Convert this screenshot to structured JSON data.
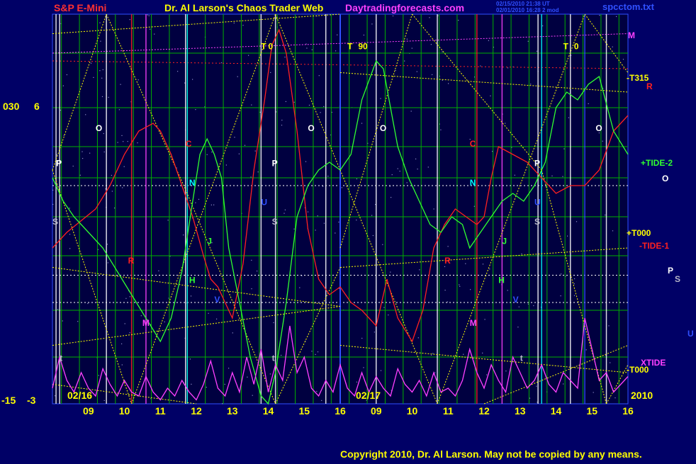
{
  "header": {
    "left_title": "S&P E-Mini",
    "center_title": "Dr. Al Larson's Chaos Trader Web",
    "site": "Daytradingforecasts.com",
    "stamp1": "02/15/2010 21:38 UT",
    "stamp2": "02/01/2010 16:28 2 mod",
    "file": "spcctom.txt"
  },
  "footer": {
    "copyright": "Copyright 2010, Dr. Al Larson. May not be copied by any means."
  },
  "left_scale": {
    "top_a": "030",
    "top_b": "6",
    "bottom_a": "-15",
    "bottom_b": "-3"
  },
  "colors": {
    "background": "#000066",
    "grid_green": "#00b000",
    "white": "#ffffff",
    "red": "#ff2020",
    "magenta": "#ff40ff",
    "yellow": "#ffff00",
    "green": "#30ff30",
    "cyan": "#00ffff",
    "blue": "#3050ff",
    "gray": "#b8b8c8"
  },
  "chart_data": {
    "type": "line",
    "title": "S&P E-Mini",
    "date_labels": [
      "02/16",
      "02/17"
    ],
    "year_label": "2010",
    "x_ticks": [
      "09",
      "10",
      "11",
      "12",
      "13",
      "14",
      "15",
      "16",
      "09",
      "10",
      "11",
      "12",
      "13",
      "14",
      "15",
      "16"
    ],
    "right_labels": [
      {
        "text": "M",
        "color": "magenta"
      },
      {
        "text": "-T315",
        "color": "yellow"
      },
      {
        "text": "R",
        "color": "red"
      },
      {
        "text": "+TIDE-2",
        "color": "green"
      },
      {
        "text": "O",
        "color": "white"
      },
      {
        "text": "+T000",
        "color": "yellow"
      },
      {
        "text": "-TIDE-1",
        "color": "red"
      },
      {
        "text": "P",
        "color": "white"
      },
      {
        "text": "S",
        "color": "gray"
      },
      {
        "text": "U",
        "color": "blue"
      },
      {
        "text": "XTIDE",
        "color": "magenta"
      },
      {
        "text": "-T000",
        "color": "yellow"
      }
    ],
    "day1_markers": [
      {
        "text": "O",
        "color": "white"
      },
      {
        "text": "P",
        "color": "white"
      },
      {
        "text": "S",
        "color": "gray"
      },
      {
        "text": "R",
        "color": "red"
      },
      {
        "text": "M",
        "color": "magenta"
      },
      {
        "text": "t",
        "color": "gray"
      },
      {
        "text": "C",
        "color": "red"
      },
      {
        "text": "N",
        "color": "cyan"
      },
      {
        "text": "H",
        "color": "green"
      },
      {
        "text": "J",
        "color": "green"
      },
      {
        "text": "V",
        "color": "blue"
      },
      {
        "text": "T",
        "color": "yellow"
      },
      {
        "text": "0",
        "color": "yellow"
      },
      {
        "text": "U",
        "color": "blue"
      },
      {
        "text": "P",
        "color": "white"
      },
      {
        "text": "S",
        "color": "gray"
      },
      {
        "text": "O",
        "color": "white"
      },
      {
        "text": "t",
        "color": "gray"
      }
    ],
    "day2_markers": [
      {
        "text": "T",
        "color": "yellow"
      },
      {
        "text": "90",
        "color": "yellow"
      },
      {
        "text": "O",
        "color": "white"
      },
      {
        "text": "R",
        "color": "red"
      },
      {
        "text": "M",
        "color": "magenta"
      },
      {
        "text": "C",
        "color": "red"
      },
      {
        "text": "N",
        "color": "cyan"
      },
      {
        "text": "J",
        "color": "green"
      },
      {
        "text": "H",
        "color": "green"
      },
      {
        "text": "V",
        "color": "blue"
      },
      {
        "text": "U",
        "color": "blue"
      },
      {
        "text": "P",
        "color": "white"
      },
      {
        "text": "S",
        "color": "gray"
      },
      {
        "text": "T",
        "color": "yellow"
      },
      {
        "text": "0",
        "color": "yellow"
      },
      {
        "text": "O",
        "color": "white"
      },
      {
        "text": "t",
        "color": "gray"
      }
    ],
    "series": [
      {
        "color": "red",
        "x": [
          8.0,
          8.4,
          8.8,
          9.2,
          9.6,
          10.0,
          10.4,
          10.8,
          11.0,
          11.3,
          11.6,
          11.9,
          12.2,
          12.4,
          12.6,
          12.8,
          13.0,
          13.3,
          13.6,
          13.9,
          14.1,
          14.3,
          14.5,
          14.8,
          15.1,
          15.4,
          15.7,
          16.0,
          16.3,
          16.6,
          17.0,
          17.3,
          17.6,
          18.0,
          18.3,
          18.6,
          18.9,
          19.2,
          19.5,
          19.8,
          20.0,
          20.2,
          20.4,
          20.8,
          21.2,
          21.6,
          22.0,
          22.4,
          22.8,
          23.2,
          23.6,
          24.0
        ],
        "y": [
          40,
          44,
          47,
          50,
          56,
          64,
          70,
          72,
          70,
          64,
          56,
          48,
          38,
          32,
          30,
          26,
          22,
          36,
          60,
          78,
          92,
          96,
          90,
          70,
          45,
          32,
          28,
          30,
          26,
          24,
          20,
          32,
          22,
          16,
          24,
          40,
          46,
          50,
          48,
          46,
          48,
          58,
          66,
          64,
          62,
          58,
          54,
          56,
          56,
          60,
          70,
          74
        ]
      },
      {
        "color": "green",
        "x": [
          8.0,
          8.3,
          8.6,
          9.0,
          9.4,
          9.8,
          10.2,
          10.6,
          11.0,
          11.3,
          11.6,
          11.9,
          12.1,
          12.3,
          12.5,
          12.7,
          12.9,
          13.2,
          13.5,
          13.8,
          14.0,
          14.2,
          14.5,
          14.8,
          15.1,
          15.4,
          15.7,
          16.0,
          16.3,
          16.6,
          17.0,
          17.2,
          17.4,
          17.6,
          17.9,
          18.2,
          18.5,
          18.8,
          19.1,
          19.4,
          19.6,
          19.9,
          20.2,
          20.5,
          20.8,
          21.1,
          21.4,
          21.7,
          22.0,
          22.3,
          22.6,
          22.9,
          23.2,
          23.6,
          24.0
        ],
        "y": [
          58,
          52,
          48,
          44,
          40,
          34,
          28,
          22,
          16,
          22,
          34,
          52,
          64,
          68,
          64,
          58,
          40,
          26,
          12,
          2,
          0,
          8,
          26,
          48,
          56,
          60,
          62,
          60,
          64,
          78,
          88,
          86,
          76,
          66,
          58,
          52,
          46,
          44,
          48,
          46,
          40,
          44,
          48,
          52,
          54,
          52,
          56,
          62,
          76,
          80,
          78,
          82,
          84,
          70,
          64
        ]
      },
      {
        "color": "magenta",
        "x": [
          8.0,
          8.2,
          8.4,
          8.6,
          8.8,
          9.0,
          9.2,
          9.4,
          9.6,
          9.8,
          10.0,
          10.2,
          10.4,
          10.6,
          10.8,
          11.0,
          11.2,
          11.4,
          11.6,
          11.8,
          12.0,
          12.2,
          12.4,
          12.6,
          12.8,
          13.0,
          13.2,
          13.4,
          13.6,
          13.8,
          14.0,
          14.2,
          14.4,
          14.6,
          14.8,
          15.0,
          15.2,
          15.4,
          15.6,
          15.8,
          16.0,
          16.2,
          16.4,
          16.6,
          16.8,
          17.0,
          17.2,
          17.4,
          17.6,
          17.8,
          18.0,
          18.2,
          18.4,
          18.6,
          18.8,
          19.0,
          19.2,
          19.4,
          19.6,
          19.8,
          20.0,
          20.2,
          20.4,
          20.6,
          20.8,
          21.0,
          21.2,
          21.4,
          21.6,
          21.8,
          22.0,
          22.2,
          22.4,
          22.6,
          22.8,
          23.0,
          23.2,
          23.4,
          23.6,
          23.8,
          24.0
        ],
        "y": [
          4,
          12,
          6,
          3,
          8,
          4,
          2,
          9,
          5,
          2,
          6,
          3,
          2,
          7,
          3,
          1,
          4,
          2,
          6,
          3,
          1,
          5,
          11,
          4,
          2,
          8,
          3,
          12,
          5,
          14,
          3,
          10,
          6,
          20,
          8,
          12,
          4,
          2,
          6,
          3,
          10,
          4,
          2,
          8,
          3,
          7,
          4,
          2,
          9,
          5,
          3,
          6,
          2,
          8,
          3,
          4,
          2,
          6,
          14,
          8,
          4,
          10,
          6,
          3,
          12,
          8,
          4,
          6,
          10,
          5,
          3,
          8,
          6,
          4,
          22,
          14,
          6,
          8,
          3,
          5,
          7
        ]
      }
    ],
    "ylim": [
      0,
      100
    ],
    "xlim": [
      8,
      24
    ]
  }
}
